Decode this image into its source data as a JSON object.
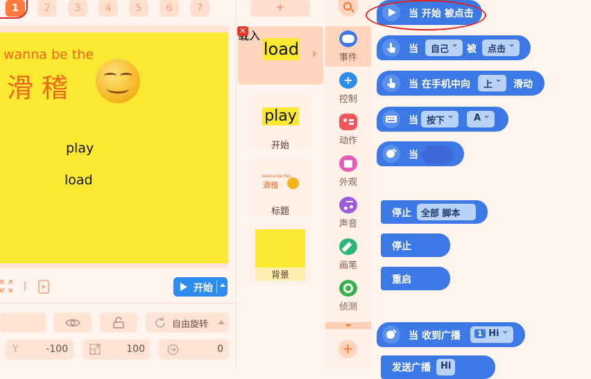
{
  "scene_tabs": [
    "1",
    "2",
    "3",
    "4",
    "5",
    "6",
    "7"
  ],
  "stage": {
    "subtitle": "wanna be the",
    "title": "滑稽",
    "text_play": "play",
    "text_load": "load"
  },
  "controls": {
    "start_label": "开始"
  },
  "properties": {
    "rotation_mode": "自由旋转",
    "y_label": "Y",
    "y_value": "-100",
    "size_value": "100",
    "direction_value": "0"
  },
  "sprites": {
    "add_label": "+",
    "delete_label": "×",
    "items": [
      {
        "thumb_text": "load",
        "name": "载入"
      },
      {
        "thumb_text": "play",
        "name": "开始"
      },
      {
        "thumb_sub": "wanna be the",
        "thumb_title": "滑稽",
        "name": "标题"
      },
      {
        "name": "背景"
      }
    ]
  },
  "categories": [
    {
      "label": "事件",
      "color": "#3d79e6"
    },
    {
      "label": "控制",
      "color": "#2e8cf0"
    },
    {
      "label": "动作",
      "color": "#f0565c"
    },
    {
      "label": "外观",
      "color": "#e85bb5"
    },
    {
      "label": "声音",
      "color": "#9b5ae0"
    },
    {
      "label": "画笔",
      "color": "#2cb67a"
    },
    {
      "label": "侦测",
      "color": "#36b04a"
    }
  ],
  "add_extension_label": "+",
  "blocks": {
    "when_start": "当 开始 被点击",
    "when": "当",
    "self": "自己",
    "clicked_word": "被",
    "clicked": "点击",
    "swipe_prefix": "当 在手机中向",
    "up": "上",
    "swipe": "滑动",
    "press": "按下",
    "key": "A",
    "stop": "停止",
    "all_scripts": "全部 脚本",
    "restart": "重启",
    "receive_prefix": "当 收到广播",
    "hi_num": "1",
    "hi": "Hi",
    "broadcast": "发送广播",
    "hi2": "Hi"
  }
}
